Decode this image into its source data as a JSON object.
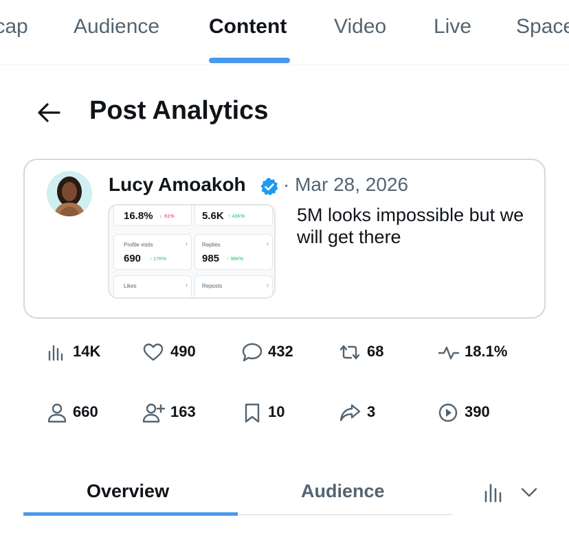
{
  "top_tabs": [
    {
      "label": "Recap"
    },
    {
      "label": "Audience"
    },
    {
      "label": "Content"
    },
    {
      "label": "Video"
    },
    {
      "label": "Live"
    },
    {
      "label": "Spaces"
    }
  ],
  "active_top_tab": "Content",
  "header": {
    "title": "Post Analytics"
  },
  "post": {
    "author": "Lucy Amoakoh",
    "date": "· Mar 28, 2026",
    "text": "5M looks impossible but we will get there",
    "image": {
      "cells": [
        {
          "label": "",
          "value": "16.8%",
          "delta": "↓ -61%",
          "direction": "down"
        },
        {
          "label": "",
          "value": "5.6K",
          "delta": "↑ 43K%",
          "direction": "up"
        },
        {
          "label": "Profile visits",
          "value": "690",
          "delta": "↑ 17K%",
          "direction": "up"
        },
        {
          "label": "Replies",
          "value": "985",
          "delta": "↑ 98K%",
          "direction": "up"
        },
        {
          "label": "Likes",
          "value": "",
          "delta": "",
          "direction": "up"
        },
        {
          "label": "Reposts",
          "value": "",
          "delta": "",
          "direction": "up"
        }
      ]
    }
  },
  "stats_row1": [
    {
      "icon": "bar-chart-icon",
      "value": "14K"
    },
    {
      "icon": "heart-icon",
      "value": "490"
    },
    {
      "icon": "reply-bubble-icon",
      "value": "432"
    },
    {
      "icon": "repost-icon",
      "value": "68"
    },
    {
      "icon": "pulse-icon",
      "value": "18.1%"
    }
  ],
  "stats_row2": [
    {
      "icon": "person-icon",
      "value": "660"
    },
    {
      "icon": "person-add-icon",
      "value": "163"
    },
    {
      "icon": "bookmark-icon",
      "value": "10"
    },
    {
      "icon": "share-icon",
      "value": "3"
    },
    {
      "icon": "play-circle-icon",
      "value": "390"
    }
  ],
  "sub_tabs": [
    {
      "label": "Overview"
    },
    {
      "label": "Audience"
    }
  ],
  "colors": {
    "accent": "#4a99e9",
    "muted_text": "#536471",
    "border": "#cfd9de",
    "verified": "#1d9bf0"
  }
}
